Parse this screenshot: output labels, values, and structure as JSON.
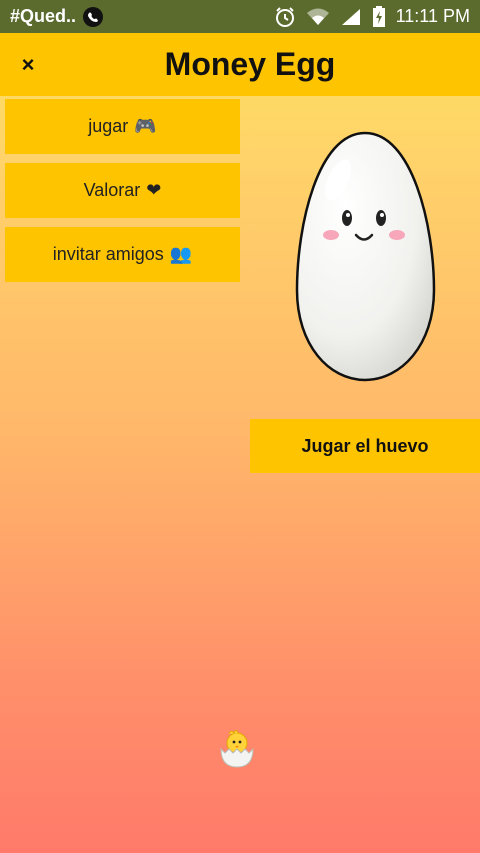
{
  "status_bar": {
    "notification_text": "#Qued..",
    "time": "11:11 PM",
    "icons": [
      "whatsapp-icon",
      "alarm-icon",
      "wifi-icon",
      "signal-icon",
      "battery-charging-icon"
    ]
  },
  "app_bar": {
    "close_label": "×",
    "title": "Money Egg"
  },
  "menu": {
    "items": [
      {
        "label": "jugar",
        "icon": "gamepad-icon",
        "glyph": "🎮"
      },
      {
        "label": "Valorar",
        "icon": "heart-icon",
        "glyph": "❤"
      },
      {
        "label": "invitar amigos",
        "icon": "people-icon",
        "glyph": "👥"
      }
    ]
  },
  "main": {
    "play_label": "Jugar el huevo"
  },
  "colors": {
    "status_bar": "#5b6b2d",
    "accent": "#ffc400",
    "gradient_top": "#fde35a",
    "gradient_bottom": "#ff7a6a"
  }
}
